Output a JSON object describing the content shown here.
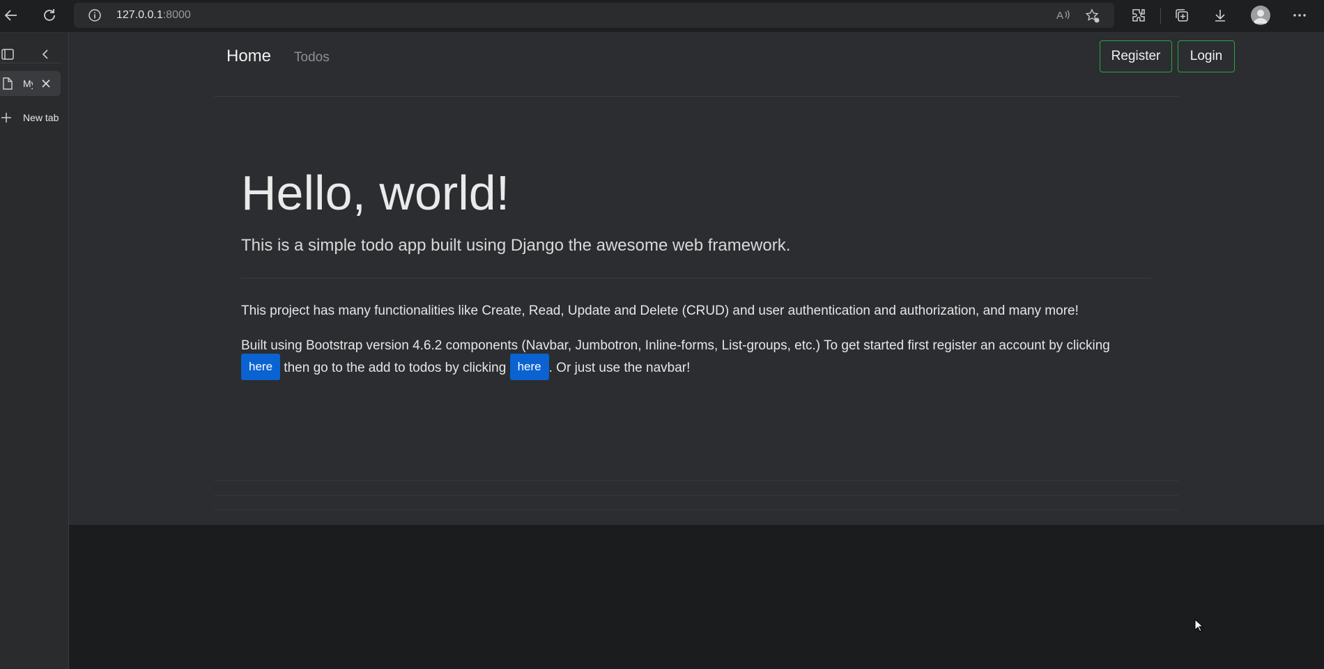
{
  "browser": {
    "url_host": "127.0.0.1",
    "url_port": ":8000",
    "icons": [
      "back-icon",
      "refresh-icon",
      "info-icon",
      "read-aloud-icon",
      "favorite-icon",
      "extensions-icon",
      "collections-icon",
      "downloads-icon",
      "profile-icon",
      "more-icon"
    ]
  },
  "sidebar": {
    "active_tab_label": "My",
    "new_tab_label": "New tab"
  },
  "navbar": {
    "brand": "Home",
    "link_todos": "Todos",
    "register_label": "Register",
    "login_label": "Login",
    "button_border_color": "#28a745"
  },
  "hero": {
    "title": "Hello, world!",
    "lead": "This is a simple todo app built using Django the awesome web framework.",
    "para1": "This project has many functionalities like Create, Read, Update and Delete (CRUD) and user authentication and authorization, and many more!",
    "para2_part1": "Built using Bootstrap version 4.6.2 components (Navbar, Jumbotron, Inline-forms, List-groups, etc.) To get started first register an account by clicking",
    "here_label_1": "here",
    "para2_part2": " then go to the add to todos by clicking ",
    "here_label_2": "here",
    "para2_part3": ". Or just use the navbar!",
    "link_button_color": "#0a63d0"
  }
}
